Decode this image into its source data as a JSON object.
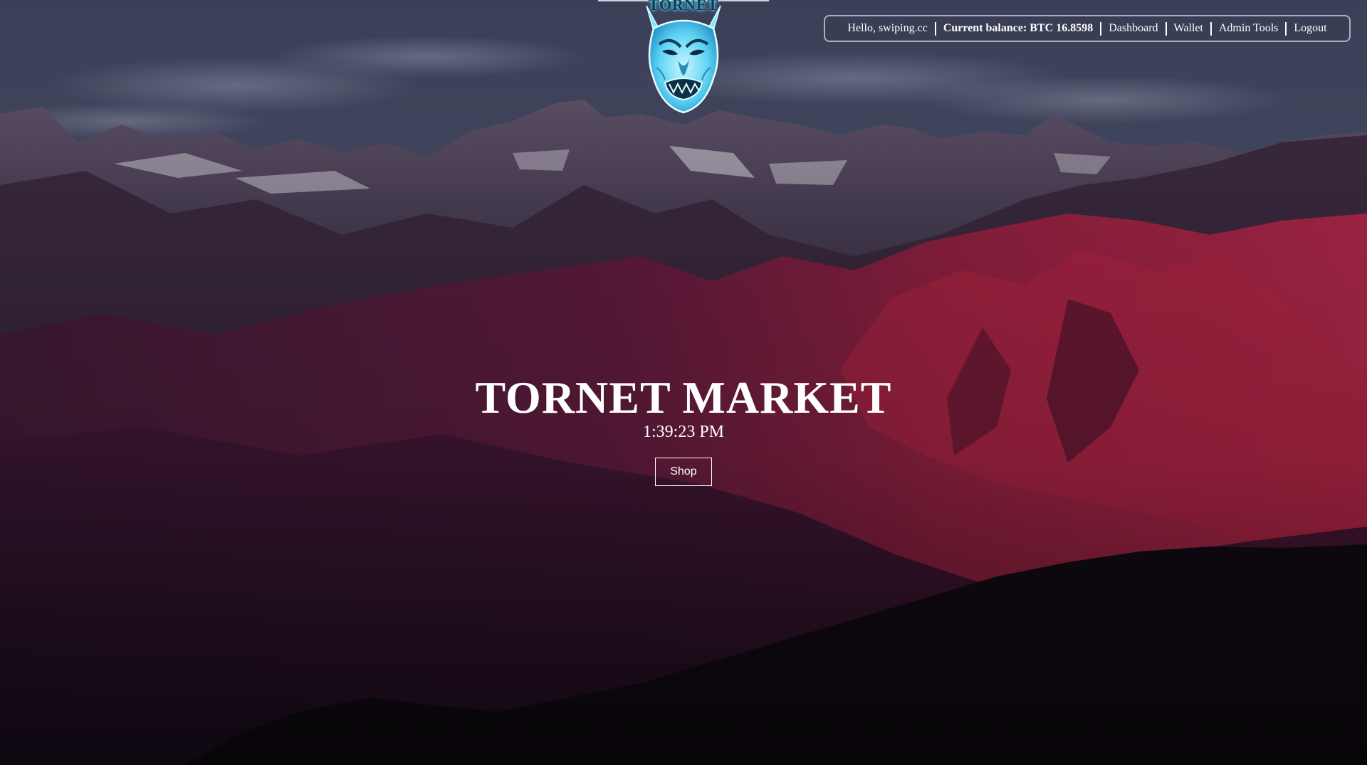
{
  "nav": {
    "greeting": "Hello, swiping.cc",
    "balance": "Current balance: BTC 16.8598",
    "dashboard": "Dashboard",
    "wallet": "Wallet",
    "admin_tools": "Admin Tools",
    "logout": "Logout"
  },
  "logo": {
    "text": "TORNET",
    "icon": "oni-mask-icon"
  },
  "hero": {
    "title": "TORNET MARKET",
    "clock": "1:39:23 PM",
    "shop_label": "Shop"
  },
  "colors": {
    "text": "#ffffff",
    "accent_glow": "#46c9f2",
    "mountain_red": "#8e1d3c",
    "sky": "#4a5068"
  }
}
